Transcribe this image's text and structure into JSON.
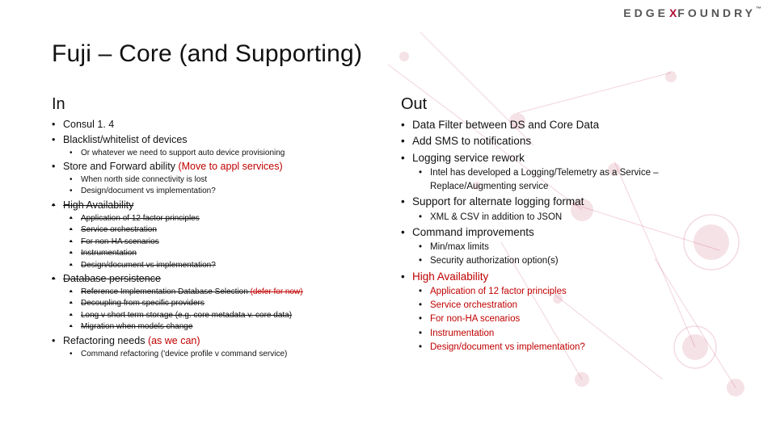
{
  "logo": {
    "left": "EDGE",
    "x": "X",
    "right": "FOUNDRY",
    "tm": "™"
  },
  "title": "Fuji – Core (and Supporting)",
  "in": {
    "heading": "In",
    "items": [
      {
        "t": "Consul 1. 4"
      },
      {
        "t": "Blacklist/whitelist of devices",
        "sub": [
          {
            "t": "Or whatever we need to support auto device provisioning"
          }
        ]
      },
      {
        "t": "Store and Forward ability ",
        "red": "(Move to appl services)",
        "sub": [
          {
            "t": "When north side connectivity is lost"
          },
          {
            "t": "Design/document vs implementation?"
          }
        ]
      },
      {
        "t": "High Availability",
        "strike": true,
        "sub": [
          {
            "t": "Application of 12 factor principles",
            "strike": true
          },
          {
            "t": "Service orchestration",
            "strike": true
          },
          {
            "t": "For non-HA scenarios",
            "strike": true
          },
          {
            "t": "Instrumentation",
            "strike": true
          },
          {
            "t": "Design/document vs implementation?",
            "strike": true
          }
        ]
      },
      {
        "t": "Database persistence",
        "strike": true,
        "sub": [
          {
            "t": "Reference Implementation Database Selection ",
            "strike": true,
            "red": "(defer for now)",
            "redStrike": true
          },
          {
            "t": "Decoupling from specific providers",
            "strike": true
          },
          {
            "t": "Long v short term storage (e.g. core metadata v. core data)",
            "strike": true
          },
          {
            "t": "Migration when models change",
            "strike": true
          }
        ]
      },
      {
        "t": "Refactoring needs ",
        "red": "(as we can)",
        "sub": [
          {
            "t": "Command refactoring ('device profile v command service)"
          }
        ]
      }
    ]
  },
  "out": {
    "heading": "Out",
    "items": [
      {
        "t": "Data Filter between DS and Core Data"
      },
      {
        "t": "Add SMS to notifications"
      },
      {
        "t": "Logging service rework",
        "sub": [
          {
            "t": "Intel has developed a Logging/Telemetry as a Service – Replace/Augmenting service"
          }
        ]
      },
      {
        "t": "Support for alternate logging format",
        "sub": [
          {
            "t": "XML & CSV in addition to JSON"
          }
        ]
      },
      {
        "t": "Command improvements",
        "sub": [
          {
            "t": "Min/max limits"
          },
          {
            "t": "Security authorization option(s)"
          }
        ]
      },
      {
        "t": "High Availability",
        "red_self": true,
        "sub": [
          {
            "t": "Application of 12 factor principles",
            "red": true
          },
          {
            "t": "Service orchestration",
            "red": true
          },
          {
            "t": "For non-HA scenarios",
            "red": true
          },
          {
            "t": "Instrumentation",
            "red": true
          },
          {
            "t": "Design/document vs implementation?",
            "red": true
          }
        ]
      }
    ]
  }
}
